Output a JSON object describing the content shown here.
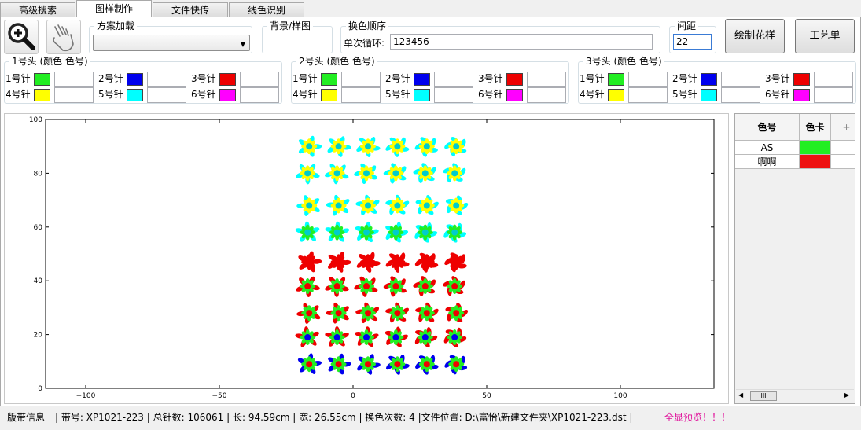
{
  "tabs": [
    {
      "label": "高级搜索"
    },
    {
      "label": "图样制作"
    },
    {
      "label": "文件快传"
    },
    {
      "label": "线色识别"
    }
  ],
  "toolbar": {
    "zoom_icon": "magnifier-plus-icon",
    "hand_icon": "hand-pointer-icon",
    "scheme_load_label": "方案加载",
    "scheme_value": "",
    "background_label": "背景/样图",
    "color_order_label": "换色顺序",
    "single_cycle_label": "单次循环:",
    "single_cycle_value": "123456",
    "spacing_label": "间距",
    "spacing_value": "22",
    "draw_pattern_button": "绘制花样",
    "process_sheet_button": "工艺单"
  },
  "heads": [
    {
      "title": "1号头 (颜色  色号)",
      "needles": [
        {
          "label": "1号针",
          "color": "#22ee22",
          "value": ""
        },
        {
          "label": "2号针",
          "color": "#0000ee",
          "value": ""
        },
        {
          "label": "3号针",
          "color": "#ee0000",
          "value": ""
        },
        {
          "label": "4号针",
          "color": "#ffff00",
          "value": ""
        },
        {
          "label": "5号针",
          "color": "#00ffff",
          "value": ""
        },
        {
          "label": "6号针",
          "color": "#ff00ff",
          "value": ""
        }
      ]
    },
    {
      "title": "2号头 (颜色  色号)",
      "needles": [
        {
          "label": "1号针",
          "color": "#22ee22",
          "value": ""
        },
        {
          "label": "2号针",
          "color": "#0000ee",
          "value": ""
        },
        {
          "label": "3号针",
          "color": "#ee0000",
          "value": ""
        },
        {
          "label": "4号针",
          "color": "#ffff00",
          "value": ""
        },
        {
          "label": "5号针",
          "color": "#00ffff",
          "value": ""
        },
        {
          "label": "6号针",
          "color": "#ff00ff",
          "value": ""
        }
      ]
    },
    {
      "title": "3号头 (颜色  色号)",
      "needles": [
        {
          "label": "1号针",
          "color": "#22ee22",
          "value": ""
        },
        {
          "label": "2号针",
          "color": "#0000ee",
          "value": ""
        },
        {
          "label": "3号针",
          "color": "#ee0000",
          "value": ""
        },
        {
          "label": "4号针",
          "color": "#ffff00",
          "value": ""
        },
        {
          "label": "5号针",
          "color": "#00ffff",
          "value": ""
        },
        {
          "label": "6号针",
          "color": "#ff00ff",
          "value": ""
        }
      ]
    }
  ],
  "chart_data": {
    "type": "scatter",
    "title": "",
    "xlabel": "",
    "ylabel": "",
    "xlim": [
      -115,
      135
    ],
    "ylim": [
      0,
      100
    ],
    "xticks": [
      -100,
      -50,
      0,
      50,
      100
    ],
    "yticks": [
      0,
      20,
      40,
      60,
      80,
      100
    ],
    "grid": false,
    "rows": [
      {
        "y": 90,
        "kind": "flower",
        "petal": "#ffff00",
        "center": "#00cccc",
        "leaf": "#00ffff"
      },
      {
        "y": 80,
        "kind": "flower",
        "petal": "#ffff00",
        "center": "#00cccc",
        "leaf": "#00ffff"
      },
      {
        "y": 68,
        "kind": "flower",
        "petal": "#ffff00",
        "center": "#00cccc",
        "leaf": "#00ffff"
      },
      {
        "y": 58,
        "kind": "flower",
        "petal": "#22ee22",
        "center": "#00cccc",
        "leaf": "#00ffff"
      },
      {
        "y": 47,
        "kind": "flower",
        "petal": "#ee0000",
        "center": "#ee0000",
        "leaf": "#ee0000"
      },
      {
        "y": 38,
        "kind": "flower",
        "petal": "#22ee22",
        "center": "#ee0000",
        "leaf": "#ee0000"
      },
      {
        "y": 28,
        "kind": "flower",
        "petal": "#22ee22",
        "center": "#ee0000",
        "leaf": "#ee0000"
      },
      {
        "y": 19,
        "kind": "flower",
        "petal": "#22ee22",
        "center": "#0000ee",
        "leaf": "#ee0000"
      },
      {
        "y": 9,
        "kind": "flower",
        "petal": "#22ee22",
        "center": "#ee0000",
        "leaf": "#0000ee"
      }
    ],
    "columns_x": [
      -17,
      -6,
      5,
      16,
      27,
      38
    ]
  },
  "color_table": {
    "headers": [
      "色号",
      "色卡",
      "+"
    ],
    "rows": [
      {
        "name": "AS",
        "color": "#22ee22"
      },
      {
        "name": "啊啊",
        "color": "#ee1111"
      }
    ],
    "scroll_thumb": "III"
  },
  "status": {
    "label": "版带信息",
    "info": "| 带号: XP1021-223 | 总针数: 106061 | 长: 94.59cm | 宽: 26.55cm | 换色次数: 4 |文件位置: D:\\富怡\\新建文件夹\\XP1021-223.dst |",
    "preview": "全显预览！！！",
    "preview_color": "#e0109a"
  }
}
